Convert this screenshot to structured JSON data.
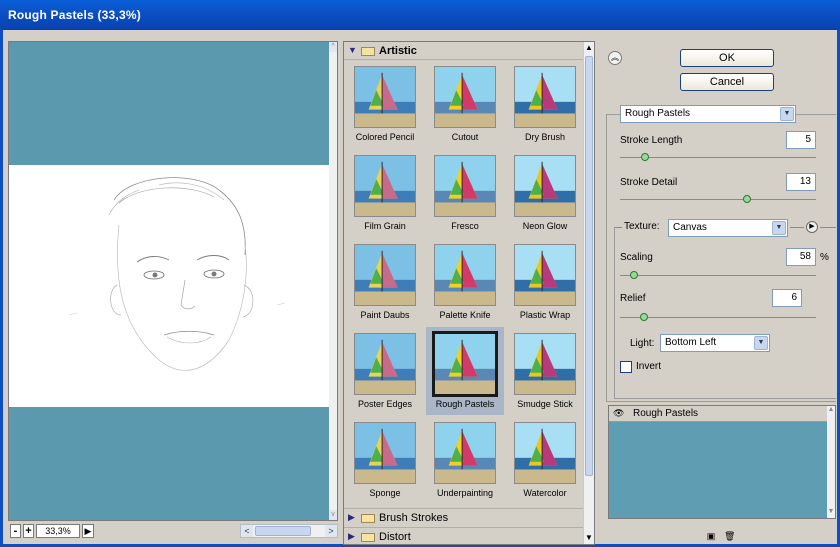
{
  "window": {
    "title": "Rough Pastels (33,3%)"
  },
  "preview": {
    "zoom_minus": "-",
    "zoom_plus": "+",
    "zoom_value": "33,3%",
    "zoom_arrow": "▶",
    "scroll_left": "<",
    "scroll_right": ">",
    "scroll_up": "^",
    "scroll_down": "v"
  },
  "gallery": {
    "category": "Artistic",
    "filters": [
      {
        "name": "Colored Pencil"
      },
      {
        "name": "Cutout"
      },
      {
        "name": "Dry Brush"
      },
      {
        "name": "Film Grain"
      },
      {
        "name": "Fresco"
      },
      {
        "name": "Neon Glow"
      },
      {
        "name": "Paint Daubs"
      },
      {
        "name": "Palette Knife"
      },
      {
        "name": "Plastic Wrap"
      },
      {
        "name": "Poster Edges"
      },
      {
        "name": "Rough Pastels"
      },
      {
        "name": "Smudge Stick"
      },
      {
        "name": "Sponge"
      },
      {
        "name": "Underpainting"
      },
      {
        "name": "Watercolor"
      }
    ],
    "selected": "Rough Pastels",
    "categories_collapsed": [
      "Brush Strokes",
      "Distort"
    ]
  },
  "actions": {
    "ok": "OK",
    "cancel": "Cancel"
  },
  "settings": {
    "filter_select": "Rough Pastels",
    "stroke_length_label": "Stroke Length",
    "stroke_length_value": "5",
    "stroke_length_level": 0.125,
    "stroke_detail_label": "Stroke Detail",
    "stroke_detail_value": "13",
    "stroke_detail_level": 0.65,
    "texture_label": "Texture:",
    "texture_value": "Canvas",
    "scaling_label": "Scaling",
    "scaling_value": "58",
    "scaling_unit": "%",
    "scaling_level": 0.07,
    "relief_label": "Relief",
    "relief_value": "6",
    "relief_level": 0.12,
    "light_label": "Light:",
    "light_value": "Bottom Left",
    "invert_label": "Invert",
    "invert_checked": false
  },
  "layers": {
    "items": [
      {
        "label": "Rough Pastels"
      }
    ]
  },
  "colors": {
    "title_bar": "#0b4fc4",
    "preview_bg": "#5b9aae",
    "panel_bg": "#d4d0c8",
    "slider_thumb": "#9dd69d"
  }
}
